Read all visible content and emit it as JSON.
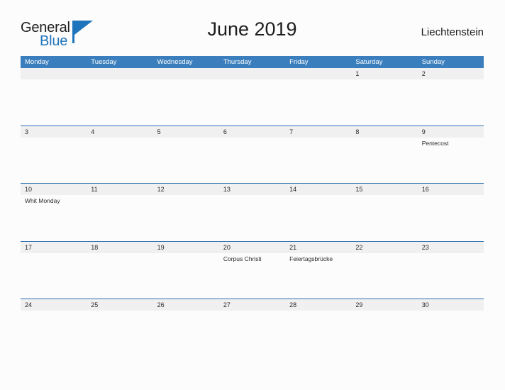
{
  "brand": {
    "name_part1": "General",
    "name_part2": "Blue",
    "flag_icon": "triangle-flag-icon",
    "color_dark": "#1d1d1d",
    "color_blue": "#1f74bb"
  },
  "header": {
    "title": "June 2019",
    "region": "Liechtenstein"
  },
  "theme": {
    "header_bar": "#3a7ebd",
    "row_divider": "#2a6fae",
    "date_strip": "#f0f0f0",
    "page_background": "#fcfcfc",
    "text": "#2b2b2b"
  },
  "calendar": {
    "month": "June",
    "year": "2019",
    "weekday_headers": [
      "Monday",
      "Tuesday",
      "Wednesday",
      "Thursday",
      "Friday",
      "Saturday",
      "Sunday"
    ],
    "weeks": [
      {
        "days": [
          {
            "num": "",
            "events": []
          },
          {
            "num": "",
            "events": []
          },
          {
            "num": "",
            "events": []
          },
          {
            "num": "",
            "events": []
          },
          {
            "num": "",
            "events": []
          },
          {
            "num": "1",
            "events": []
          },
          {
            "num": "2",
            "events": []
          }
        ]
      },
      {
        "days": [
          {
            "num": "3",
            "events": []
          },
          {
            "num": "4",
            "events": []
          },
          {
            "num": "5",
            "events": []
          },
          {
            "num": "6",
            "events": []
          },
          {
            "num": "7",
            "events": []
          },
          {
            "num": "8",
            "events": []
          },
          {
            "num": "9",
            "events": [
              "Pentecost"
            ]
          }
        ]
      },
      {
        "days": [
          {
            "num": "10",
            "events": [
              "Whit Monday"
            ]
          },
          {
            "num": "11",
            "events": []
          },
          {
            "num": "12",
            "events": []
          },
          {
            "num": "13",
            "events": []
          },
          {
            "num": "14",
            "events": []
          },
          {
            "num": "15",
            "events": []
          },
          {
            "num": "16",
            "events": []
          }
        ]
      },
      {
        "days": [
          {
            "num": "17",
            "events": []
          },
          {
            "num": "18",
            "events": []
          },
          {
            "num": "19",
            "events": []
          },
          {
            "num": "20",
            "events": [
              "Corpus Christi"
            ]
          },
          {
            "num": "21",
            "events": [
              "Feiertagsbrücke"
            ]
          },
          {
            "num": "22",
            "events": []
          },
          {
            "num": "23",
            "events": []
          }
        ]
      },
      {
        "days": [
          {
            "num": "24",
            "events": []
          },
          {
            "num": "25",
            "events": []
          },
          {
            "num": "26",
            "events": []
          },
          {
            "num": "27",
            "events": []
          },
          {
            "num": "28",
            "events": []
          },
          {
            "num": "29",
            "events": []
          },
          {
            "num": "30",
            "events": []
          }
        ]
      }
    ]
  }
}
